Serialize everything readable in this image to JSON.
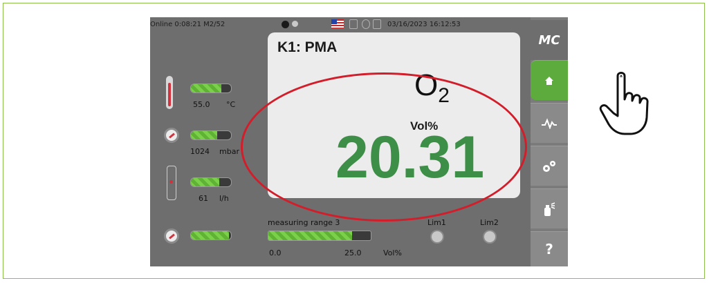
{
  "status": {
    "left": "Online 0:08:21 M2/52",
    "datetime": "03/16/2023 16:12:53"
  },
  "left_panel": {
    "temperature": {
      "value": "55.0",
      "unit": "°C",
      "bar_level": 0.75
    },
    "pressure": {
      "value": "1024",
      "unit": "mbar",
      "bar_level": 0.65
    },
    "flow": {
      "value": "61",
      "unit": "l/h",
      "bar_level": 0.7
    },
    "fourth_bar_level": 0.95
  },
  "main_panel": {
    "channel": "K1:  PMA",
    "gas": "O",
    "gas_sub": "2",
    "unit": "Vol%",
    "value": "20.31"
  },
  "range": {
    "label": "measuring range 3",
    "min": "0.0",
    "max": "25.0",
    "unit": "Vol%",
    "bar_level": 0.82
  },
  "limits": {
    "lim1": "Lim1",
    "lim2": "Lim2"
  },
  "sidebar": {
    "logo": "MC",
    "help": "?"
  },
  "colors": {
    "accent_green": "#5cab3c",
    "value_green": "#3d8e46",
    "highlight_red": "#d21e2b",
    "frame_green": "#8cc04b"
  }
}
